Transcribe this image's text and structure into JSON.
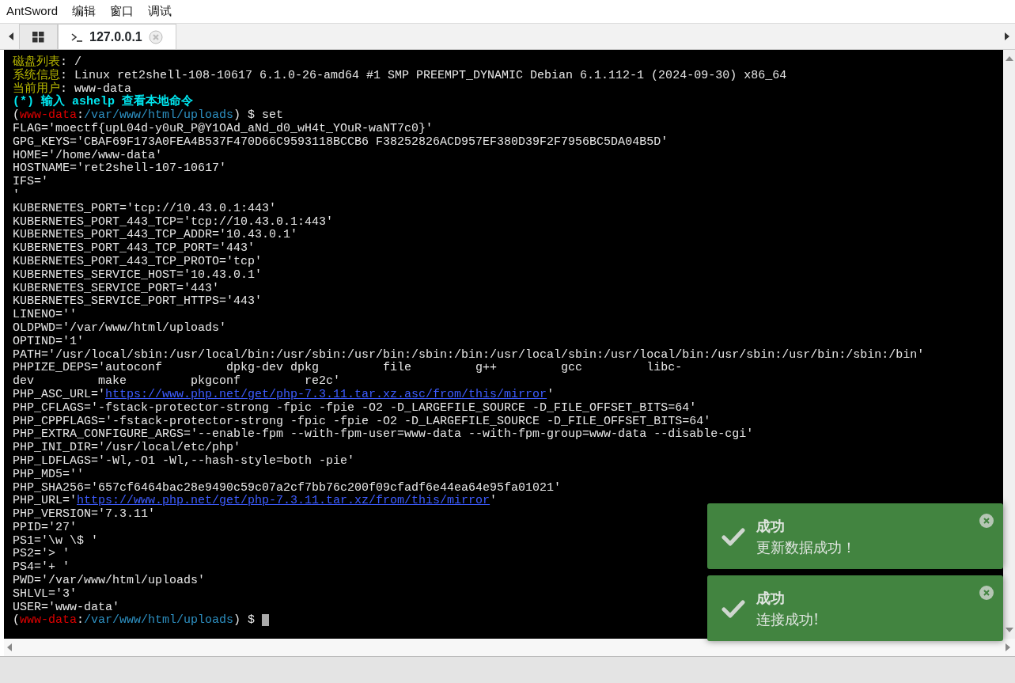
{
  "menu": [
    "AntSword",
    "编辑",
    "窗口",
    "调试"
  ],
  "tabs": [
    {
      "kind": "grid",
      "selected": false
    },
    {
      "kind": "terminal",
      "label": "127.0.0.1",
      "selected": true
    }
  ],
  "terminal": {
    "cursor": true,
    "lines": [
      [
        {
          "kind": "label",
          "t": "磁盘列表"
        },
        {
          "kind": "plain",
          "t": ": /"
        }
      ],
      [
        {
          "kind": "label",
          "t": "系统信息"
        },
        {
          "kind": "plain",
          "t": ": Linux ret2shell-108-10617 6.1.0-26-amd64 #1 SMP PREEMPT_DYNAMIC Debian 6.1.112-1 (2024-09-30) x86_64"
        }
      ],
      [
        {
          "kind": "label",
          "t": "当前用户"
        },
        {
          "kind": "plain",
          "t": ": www-data"
        }
      ],
      [
        {
          "kind": "hint",
          "t": "(*) 输入 ashelp 查看本地命令"
        }
      ],
      [
        {
          "kind": "plain",
          "t": "("
        },
        {
          "kind": "user",
          "t": "www-data"
        },
        {
          "kind": "plain",
          "t": ":"
        },
        {
          "kind": "path",
          "t": "/var/www/html/uploads"
        },
        {
          "kind": "plain",
          "t": ") $ set"
        }
      ],
      [
        {
          "kind": "plain",
          "t": "FLAG='moectf{upL04d-y0uR_P@Y1OAd_aNd_d0_wH4t_YOuR-waNT7c0}'"
        }
      ],
      [
        {
          "kind": "plain",
          "t": "GPG_KEYS='CBAF69F173A0FEA4B537F470D66C9593118BCCB6 F38252826ACD957EF380D39F2F7956BC5DA04B5D'"
        }
      ],
      [
        {
          "kind": "plain",
          "t": "HOME='/home/www-data'"
        }
      ],
      [
        {
          "kind": "plain",
          "t": "HOSTNAME='ret2shell-107-10617'"
        }
      ],
      [
        {
          "kind": "plain",
          "t": "IFS='"
        }
      ],
      [
        {
          "kind": "plain",
          "t": "'"
        }
      ],
      [
        {
          "kind": "plain",
          "t": "KUBERNETES_PORT='tcp://10.43.0.1:443'"
        }
      ],
      [
        {
          "kind": "plain",
          "t": "KUBERNETES_PORT_443_TCP='tcp://10.43.0.1:443'"
        }
      ],
      [
        {
          "kind": "plain",
          "t": "KUBERNETES_PORT_443_TCP_ADDR='10.43.0.1'"
        }
      ],
      [
        {
          "kind": "plain",
          "t": "KUBERNETES_PORT_443_TCP_PORT='443'"
        }
      ],
      [
        {
          "kind": "plain",
          "t": "KUBERNETES_PORT_443_TCP_PROTO='tcp'"
        }
      ],
      [
        {
          "kind": "plain",
          "t": "KUBERNETES_SERVICE_HOST='10.43.0.1'"
        }
      ],
      [
        {
          "kind": "plain",
          "t": "KUBERNETES_SERVICE_PORT='443'"
        }
      ],
      [
        {
          "kind": "plain",
          "t": "KUBERNETES_SERVICE_PORT_HTTPS='443'"
        }
      ],
      [
        {
          "kind": "plain",
          "t": "LINENO=''"
        }
      ],
      [
        {
          "kind": "plain",
          "t": "OLDPWD='/var/www/html/uploads'"
        }
      ],
      [
        {
          "kind": "plain",
          "t": "OPTIND='1'"
        }
      ],
      [
        {
          "kind": "plain",
          "t": "PATH='/usr/local/sbin:/usr/local/bin:/usr/sbin:/usr/bin:/sbin:/bin:/usr/local/sbin:/usr/local/bin:/usr/sbin:/usr/bin:/sbin:/bin'"
        }
      ],
      [
        {
          "kind": "plain",
          "t": "PHPIZE_DEPS='autoconf         dpkg-dev dpkg         file         g++         gcc         libc-"
        }
      ],
      [
        {
          "kind": "plain",
          "t": "dev         make         pkgconf         re2c'"
        }
      ],
      [
        {
          "kind": "plain",
          "t": "PHP_ASC_URL='"
        },
        {
          "kind": "link",
          "t": "https://www.php.net/get/php-7.3.11.tar.xz.asc/from/this/mirror"
        },
        {
          "kind": "plain",
          "t": "'"
        }
      ],
      [
        {
          "kind": "plain",
          "t": "PHP_CFLAGS='-fstack-protector-strong -fpic -fpie -O2 -D_LARGEFILE_SOURCE -D_FILE_OFFSET_BITS=64'"
        }
      ],
      [
        {
          "kind": "plain",
          "t": "PHP_CPPFLAGS='-fstack-protector-strong -fpic -fpie -O2 -D_LARGEFILE_SOURCE -D_FILE_OFFSET_BITS=64'"
        }
      ],
      [
        {
          "kind": "plain",
          "t": "PHP_EXTRA_CONFIGURE_ARGS='--enable-fpm --with-fpm-user=www-data --with-fpm-group=www-data --disable-cgi'"
        }
      ],
      [
        {
          "kind": "plain",
          "t": "PHP_INI_DIR='/usr/local/etc/php'"
        }
      ],
      [
        {
          "kind": "plain",
          "t": "PHP_LDFLAGS='-Wl,-O1 -Wl,--hash-style=both -pie'"
        }
      ],
      [
        {
          "kind": "plain",
          "t": "PHP_MD5=''"
        }
      ],
      [
        {
          "kind": "plain",
          "t": "PHP_SHA256='657cf6464bac28e9490c59c07a2cf7bb76c200f09cfadf6e44ea64e95fa01021'"
        }
      ],
      [
        {
          "kind": "plain",
          "t": "PHP_URL='"
        },
        {
          "kind": "link",
          "t": "https://www.php.net/get/php-7.3.11.tar.xz/from/this/mirror"
        },
        {
          "kind": "plain",
          "t": "'"
        }
      ],
      [
        {
          "kind": "plain",
          "t": "PHP_VERSION='7.3.11'"
        }
      ],
      [
        {
          "kind": "plain",
          "t": "PPID='27'"
        }
      ],
      [
        {
          "kind": "plain",
          "t": "PS1='\\w \\$ '"
        }
      ],
      [
        {
          "kind": "plain",
          "t": "PS2='> '"
        }
      ],
      [
        {
          "kind": "plain",
          "t": "PS4='+ '"
        }
      ],
      [
        {
          "kind": "plain",
          "t": "PWD='/var/www/html/uploads'"
        }
      ],
      [
        {
          "kind": "plain",
          "t": "SHLVL='3'"
        }
      ],
      [
        {
          "kind": "plain",
          "t": "USER='www-data'"
        }
      ],
      [
        {
          "kind": "plain",
          "t": "("
        },
        {
          "kind": "user",
          "t": "www-data"
        },
        {
          "kind": "plain",
          "t": ":"
        },
        {
          "kind": "path",
          "t": "/var/www/html/uploads"
        },
        {
          "kind": "plain",
          "t": ") $ "
        }
      ]
    ]
  },
  "toasts": [
    {
      "title": "成功",
      "message": "更新数据成功！"
    },
    {
      "title": "成功",
      "message": "连接成功!"
    }
  ]
}
